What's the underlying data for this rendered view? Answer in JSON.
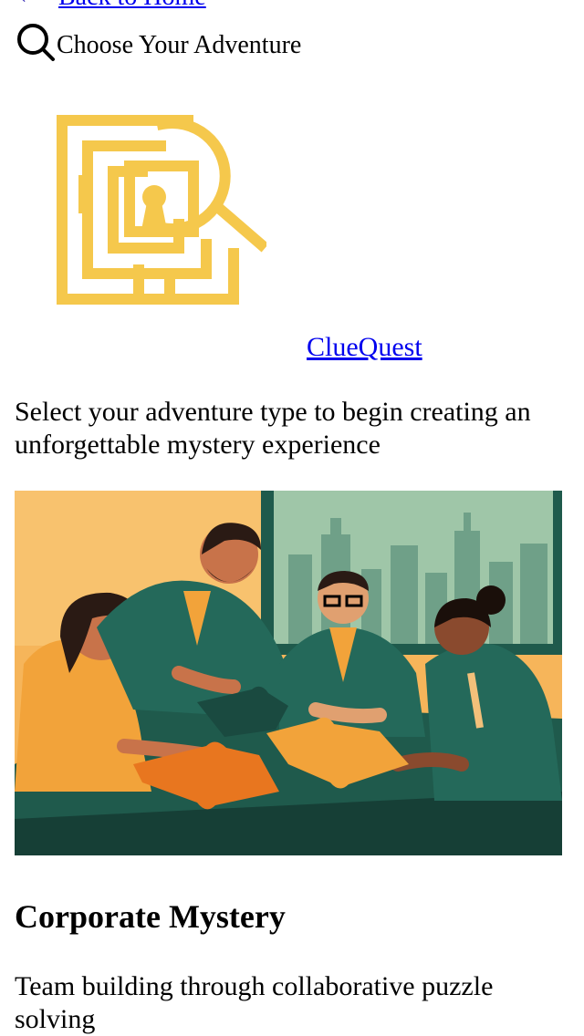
{
  "nav": {
    "back_label": "Back to Home",
    "back_icon": "arrow-left-icon"
  },
  "header": {
    "search_icon": "search-icon",
    "title": "Choose Your Adventure"
  },
  "brand": {
    "logo_icon": "maze-keyhole-magnifier-logo",
    "logo_color": "#F5C84C",
    "name": "ClueQuest"
  },
  "intro": {
    "text": "Select your adventure type to begin creating an unforgettable mystery experience"
  },
  "cards": [
    {
      "title": "Corporate Mystery",
      "description": "Team building through collaborative puzzle solving",
      "image_subject": "team-assembling-puzzle-illustration"
    }
  ],
  "colors": {
    "link": "#0000EE",
    "illustration_teal": "#1F5A4C",
    "illustration_orange": "#F2A33A"
  }
}
